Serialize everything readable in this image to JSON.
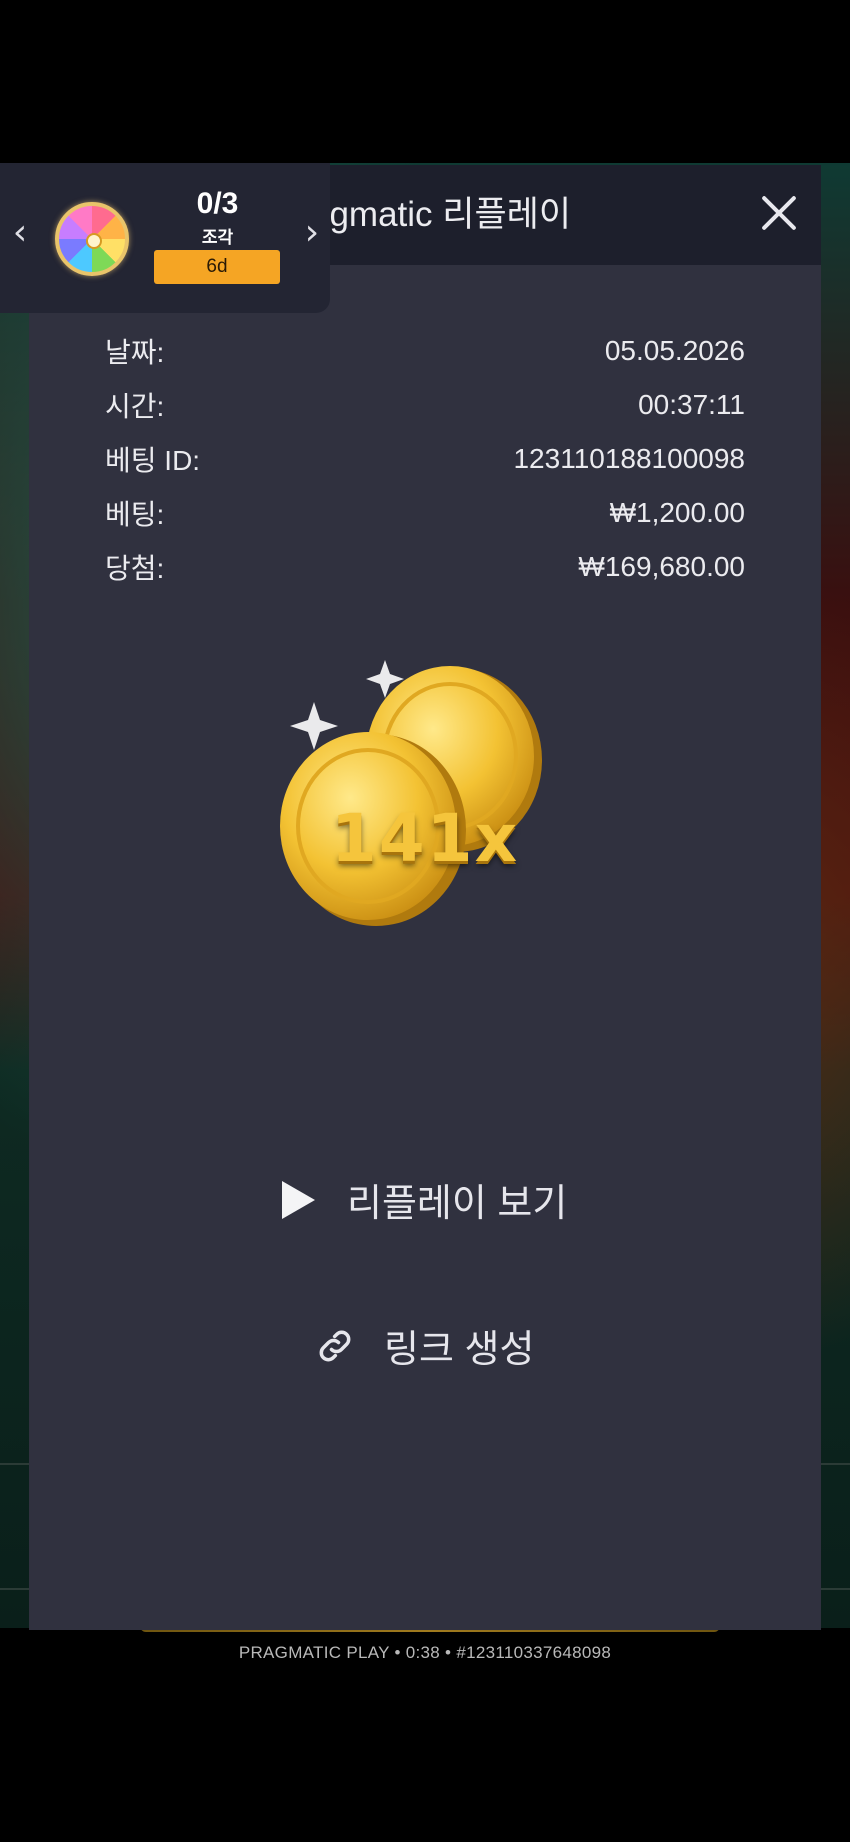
{
  "modal": {
    "title": "Pragmatic 리플레이",
    "close_icon": "close-icon"
  },
  "bet_info": [
    {
      "label": "날짜:",
      "value": "05.05.2026"
    },
    {
      "label": "시간:",
      "value": "00:37:11"
    },
    {
      "label": "베팅 ID:",
      "value": "123110188100098"
    },
    {
      "label": "베팅:",
      "value": "₩1,200.00"
    },
    {
      "label": "당첨:",
      "value": "₩169,680.00"
    }
  ],
  "win": {
    "multiplier": "141x",
    "icon": "gold-coins-icon"
  },
  "actions": {
    "watch_replay": "리플레이 보기",
    "create_link": "링크 생성"
  },
  "widget": {
    "count": "0/3",
    "unit": "조각",
    "timer": "6d",
    "icon": "prize-wheel-icon"
  },
  "footer": {
    "info": "PRAGMATIC PLAY • 0:38 • #123110337648098"
  },
  "colors": {
    "modal_bg": "#30313f",
    "header_bg": "#1d1f2c",
    "accent_orange": "#f5a524",
    "gold": "#f5c53c"
  }
}
